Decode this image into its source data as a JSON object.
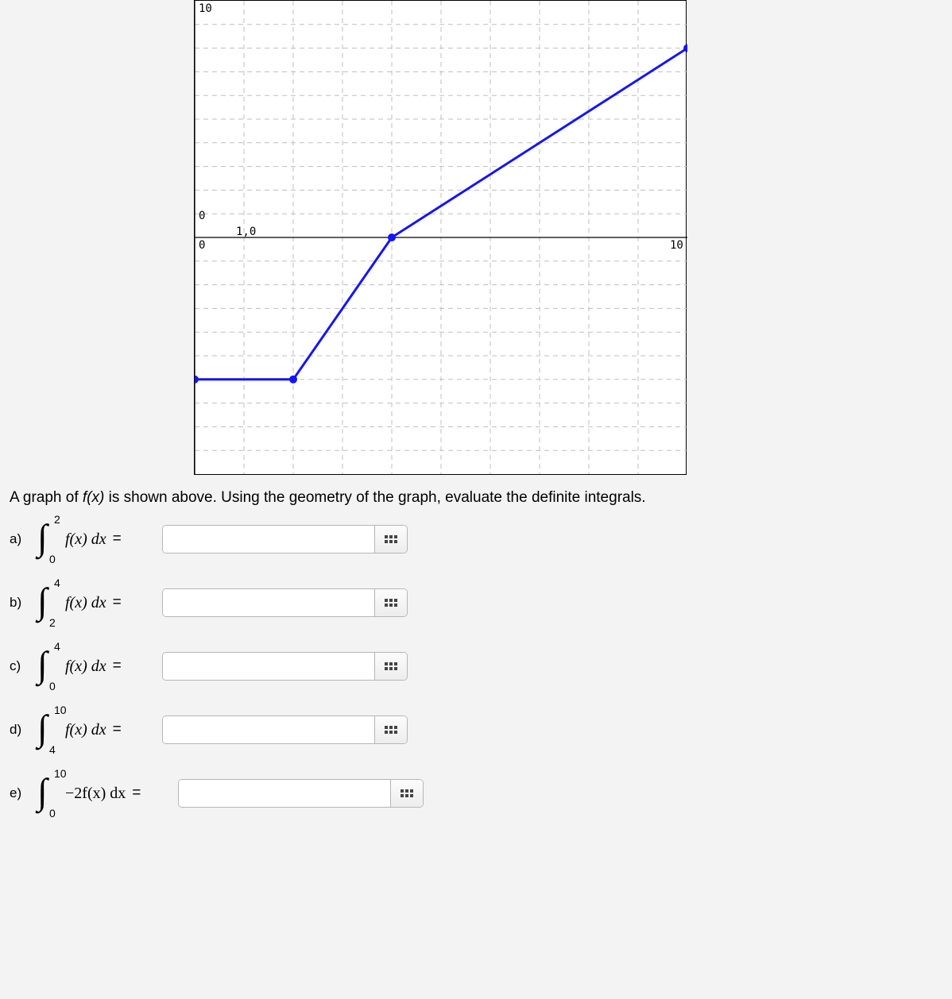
{
  "chart_data": {
    "type": "line",
    "xlabel": "",
    "ylabel": "",
    "xlim": [
      0,
      10
    ],
    "ylim": [
      -10,
      10
    ],
    "series": [
      {
        "name": "f(x)",
        "x": [
          0,
          2,
          4,
          10
        ],
        "y": [
          -6,
          -6,
          0,
          8
        ]
      }
    ],
    "ticks": {
      "y_top": "10",
      "y_zero": "0",
      "origin": "0",
      "origin_right": "1,0",
      "x_right": "10"
    }
  },
  "prompt_prefix": "A graph of ",
  "prompt_fx": "f(x)",
  "prompt_suffix": " is shown above. Using the geometry of the graph, evaluate the definite integrals.",
  "questions": {
    "a": {
      "label": "a)",
      "lower": "0",
      "upper": "2",
      "integrand": "f(x) dx",
      "equals": "="
    },
    "b": {
      "label": "b)",
      "lower": "2",
      "upper": "4",
      "integrand": "f(x) dx",
      "equals": "="
    },
    "c": {
      "label": "c)",
      "lower": "0",
      "upper": "4",
      "integrand": "f(x) dx",
      "equals": "="
    },
    "d": {
      "label": "d)",
      "lower": "4",
      "upper": "10",
      "integrand": "f(x) dx",
      "equals": "="
    },
    "e": {
      "label": "e)",
      "lower": "0",
      "upper": "10",
      "integrand": "−2f(x) dx",
      "equals": "="
    }
  }
}
